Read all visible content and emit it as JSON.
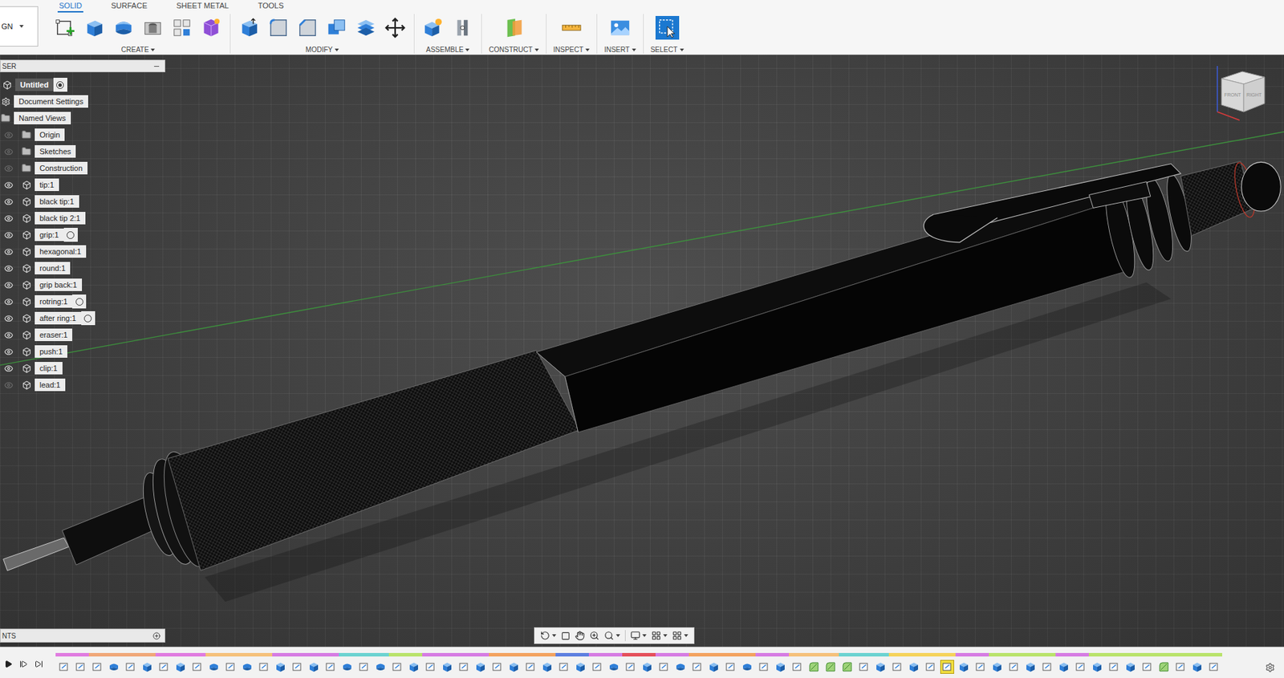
{
  "toolbar": {
    "workspace": "GN",
    "tabs": [
      {
        "label": "SOLID",
        "selected": true
      },
      {
        "label": "SURFACE",
        "selected": false
      },
      {
        "label": "SHEET METAL",
        "selected": false
      },
      {
        "label": "TOOLS",
        "selected": false
      }
    ],
    "groups": [
      {
        "label": "CREATE",
        "tools": [
          {
            "kind": "sketch"
          },
          {
            "kind": "extrude"
          },
          {
            "kind": "revolve"
          },
          {
            "kind": "hole"
          },
          {
            "kind": "pattern"
          },
          {
            "kind": "form"
          }
        ]
      },
      {
        "label": "MODIFY",
        "tools": [
          {
            "kind": "presspull"
          },
          {
            "kind": "fillet"
          },
          {
            "kind": "chamfer"
          },
          {
            "kind": "combine"
          },
          {
            "kind": "split"
          },
          {
            "kind": "move"
          }
        ]
      },
      {
        "label": "ASSEMBLE",
        "tools": [
          {
            "kind": "component"
          },
          {
            "kind": "joint"
          }
        ]
      },
      {
        "label": "CONSTRUCT",
        "tools": [
          {
            "kind": "plane"
          }
        ]
      },
      {
        "label": "INSPECT",
        "tools": [
          {
            "kind": "measure"
          }
        ]
      },
      {
        "label": "INSERT",
        "tools": [
          {
            "kind": "image"
          }
        ]
      },
      {
        "label": "SELECT",
        "tools": [
          {
            "kind": "select"
          }
        ]
      }
    ]
  },
  "browser": {
    "title": "SER",
    "items": [
      {
        "label": "Untitled",
        "kind": "root",
        "radio": true
      },
      {
        "label": "Document Settings",
        "kind": "settings"
      },
      {
        "label": "Named Views",
        "kind": "views"
      },
      {
        "label": "Origin",
        "kind": "folder",
        "visible": false
      },
      {
        "label": "Sketches",
        "kind": "folder",
        "visible": false
      },
      {
        "label": "Construction",
        "kind": "folder",
        "visible": false
      },
      {
        "label": "tip:1",
        "kind": "component",
        "visible": true,
        "radio": false
      },
      {
        "label": "black tip:1",
        "kind": "component",
        "visible": true,
        "radio": false
      },
      {
        "label": "black tip 2:1",
        "kind": "component",
        "visible": true,
        "radio": false
      },
      {
        "label": "grip:1",
        "kind": "component",
        "visible": true,
        "radio": true
      },
      {
        "label": "hexagonal:1",
        "kind": "component",
        "visible": true,
        "radio": false
      },
      {
        "label": "round:1",
        "kind": "component",
        "visible": true,
        "radio": false
      },
      {
        "label": "grip back:1",
        "kind": "component",
        "visible": true,
        "radio": false
      },
      {
        "label": "rotring:1",
        "kind": "component",
        "visible": true,
        "radio": true
      },
      {
        "label": "after ring:1",
        "kind": "component",
        "visible": true,
        "radio": true
      },
      {
        "label": "eraser:1",
        "kind": "component",
        "visible": true,
        "radio": false
      },
      {
        "label": "push:1",
        "kind": "component",
        "visible": true,
        "radio": false
      },
      {
        "label": "clip:1",
        "kind": "component",
        "visible": true,
        "radio": false
      },
      {
        "label": "lead:1",
        "kind": "component",
        "visible": false,
        "radio": false
      }
    ]
  },
  "viewcube": {
    "faces": [
      "FRONT",
      "RIGHT"
    ]
  },
  "comments": {
    "title": "NTS"
  },
  "timeline": {
    "features": [
      {
        "kind": "sketch",
        "color": "#e07be0",
        "selected": false
      },
      {
        "kind": "sketch",
        "color": "#e07be0",
        "selected": false
      },
      {
        "kind": "sketch",
        "color": "#f0a878",
        "selected": false
      },
      {
        "kind": "revolve",
        "color": "#f0a878",
        "selected": false
      },
      {
        "kind": "sketch",
        "color": "#f0a878",
        "selected": false
      },
      {
        "kind": "extrude",
        "color": "#f0a878",
        "selected": false
      },
      {
        "kind": "sketch",
        "color": "#e07be0",
        "selected": false
      },
      {
        "kind": "extrude",
        "color": "#e07be0",
        "selected": false
      },
      {
        "kind": "sketch",
        "color": "#e07be0",
        "selected": false
      },
      {
        "kind": "revolve",
        "color": "#f5c07a",
        "selected": false
      },
      {
        "kind": "sketch",
        "color": "#f5c07a",
        "selected": false
      },
      {
        "kind": "revolve",
        "color": "#f5c07a",
        "selected": false
      },
      {
        "kind": "sketch",
        "color": "#f5c07a",
        "selected": false
      },
      {
        "kind": "extrude",
        "color": "#d67be3",
        "selected": false
      },
      {
        "kind": "sketch",
        "color": "#d67be3",
        "selected": false
      },
      {
        "kind": "extrude",
        "color": "#d67be3",
        "selected": false
      },
      {
        "kind": "sketch",
        "color": "#d67be3",
        "selected": false
      },
      {
        "kind": "revolve",
        "color": "#6bd3d1",
        "selected": false
      },
      {
        "kind": "sketch",
        "color": "#6bd3d1",
        "selected": false
      },
      {
        "kind": "revolve",
        "color": "#6bd3d1",
        "selected": false
      },
      {
        "kind": "sketch",
        "color": "#b9e36b",
        "selected": false
      },
      {
        "kind": "extrude",
        "color": "#b9e36b",
        "selected": false
      },
      {
        "kind": "sketch",
        "color": "#d67be3",
        "selected": false
      },
      {
        "kind": "extrude",
        "color": "#d67be3",
        "selected": false
      },
      {
        "kind": "sketch",
        "color": "#d67be3",
        "selected": false
      },
      {
        "kind": "extrude",
        "color": "#d67be3",
        "selected": false
      },
      {
        "kind": "sketch",
        "color": "#f3a35f",
        "selected": false
      },
      {
        "kind": "extrude",
        "color": "#f3a35f",
        "selected": false
      },
      {
        "kind": "sketch",
        "color": "#f3a35f",
        "selected": false
      },
      {
        "kind": "extrude",
        "color": "#f3a35f",
        "selected": false
      },
      {
        "kind": "sketch",
        "color": "#5d7fe0",
        "selected": false
      },
      {
        "kind": "extrude",
        "color": "#5d7fe0",
        "selected": false
      },
      {
        "kind": "sketch",
        "color": "#d67be3",
        "selected": false
      },
      {
        "kind": "revolve",
        "color": "#d67be3",
        "selected": false
      },
      {
        "kind": "sketch",
        "color": "#e5505a",
        "selected": false
      },
      {
        "kind": "extrude",
        "color": "#e5505a",
        "selected": false
      },
      {
        "kind": "sketch",
        "color": "#d67be3",
        "selected": false
      },
      {
        "kind": "revolve",
        "color": "#d67be3",
        "selected": false
      },
      {
        "kind": "sketch",
        "color": "#f3a35f",
        "selected": false
      },
      {
        "kind": "extrude",
        "color": "#f3a35f",
        "selected": false
      },
      {
        "kind": "sketch",
        "color": "#f3a35f",
        "selected": false
      },
      {
        "kind": "revolve",
        "color": "#f3a35f",
        "selected": false
      },
      {
        "kind": "sketch",
        "color": "#d67be3",
        "selected": false
      },
      {
        "kind": "extrude",
        "color": "#d67be3",
        "selected": false
      },
      {
        "kind": "sketch",
        "color": "#f5c07a",
        "selected": false
      },
      {
        "kind": "fillet",
        "color": "#f5c07a",
        "selected": false
      },
      {
        "kind": "fillet",
        "color": "#f5c07a",
        "selected": false
      },
      {
        "kind": "fillet",
        "color": "#6bd3d1",
        "selected": false
      },
      {
        "kind": "sketch",
        "color": "#6bd3d1",
        "selected": false
      },
      {
        "kind": "extrude",
        "color": "#6bd3d1",
        "selected": false
      },
      {
        "kind": "sketch",
        "color": "#f5d35a",
        "selected": false
      },
      {
        "kind": "extrude",
        "color": "#f5d35a",
        "selected": false
      },
      {
        "kind": "sketch",
        "color": "#f5d35a",
        "selected": false
      },
      {
        "kind": "sketch",
        "color": "#f5d35a",
        "selected": true
      },
      {
        "kind": "extrude",
        "color": "#d67be3",
        "selected": false
      },
      {
        "kind": "sketch",
        "color": "#d67be3",
        "selected": false
      },
      {
        "kind": "extrude",
        "color": "#b9e36b",
        "selected": false
      },
      {
        "kind": "sketch",
        "color": "#b9e36b",
        "selected": false
      },
      {
        "kind": "extrude",
        "color": "#b9e36b",
        "selected": false
      },
      {
        "kind": "sketch",
        "color": "#b9e36b",
        "selected": false
      },
      {
        "kind": "extrude",
        "color": "#d67be3",
        "selected": false
      },
      {
        "kind": "sketch",
        "color": "#d67be3",
        "selected": false
      },
      {
        "kind": "extrude",
        "color": "#b9e36b",
        "selected": false
      },
      {
        "kind": "sketch",
        "color": "#b9e36b",
        "selected": false
      },
      {
        "kind": "extrude",
        "color": "#b9e36b",
        "selected": false
      },
      {
        "kind": "sketch",
        "color": "#b9e36b",
        "selected": false
      },
      {
        "kind": "fillet",
        "color": "#b9e36b",
        "selected": false
      },
      {
        "kind": "sketch",
        "color": "#b9e36b",
        "selected": false
      },
      {
        "kind": "extrude",
        "color": "#b9e36b",
        "selected": false
      },
      {
        "kind": "sketch",
        "color": "#b9e36b",
        "selected": false
      }
    ]
  }
}
